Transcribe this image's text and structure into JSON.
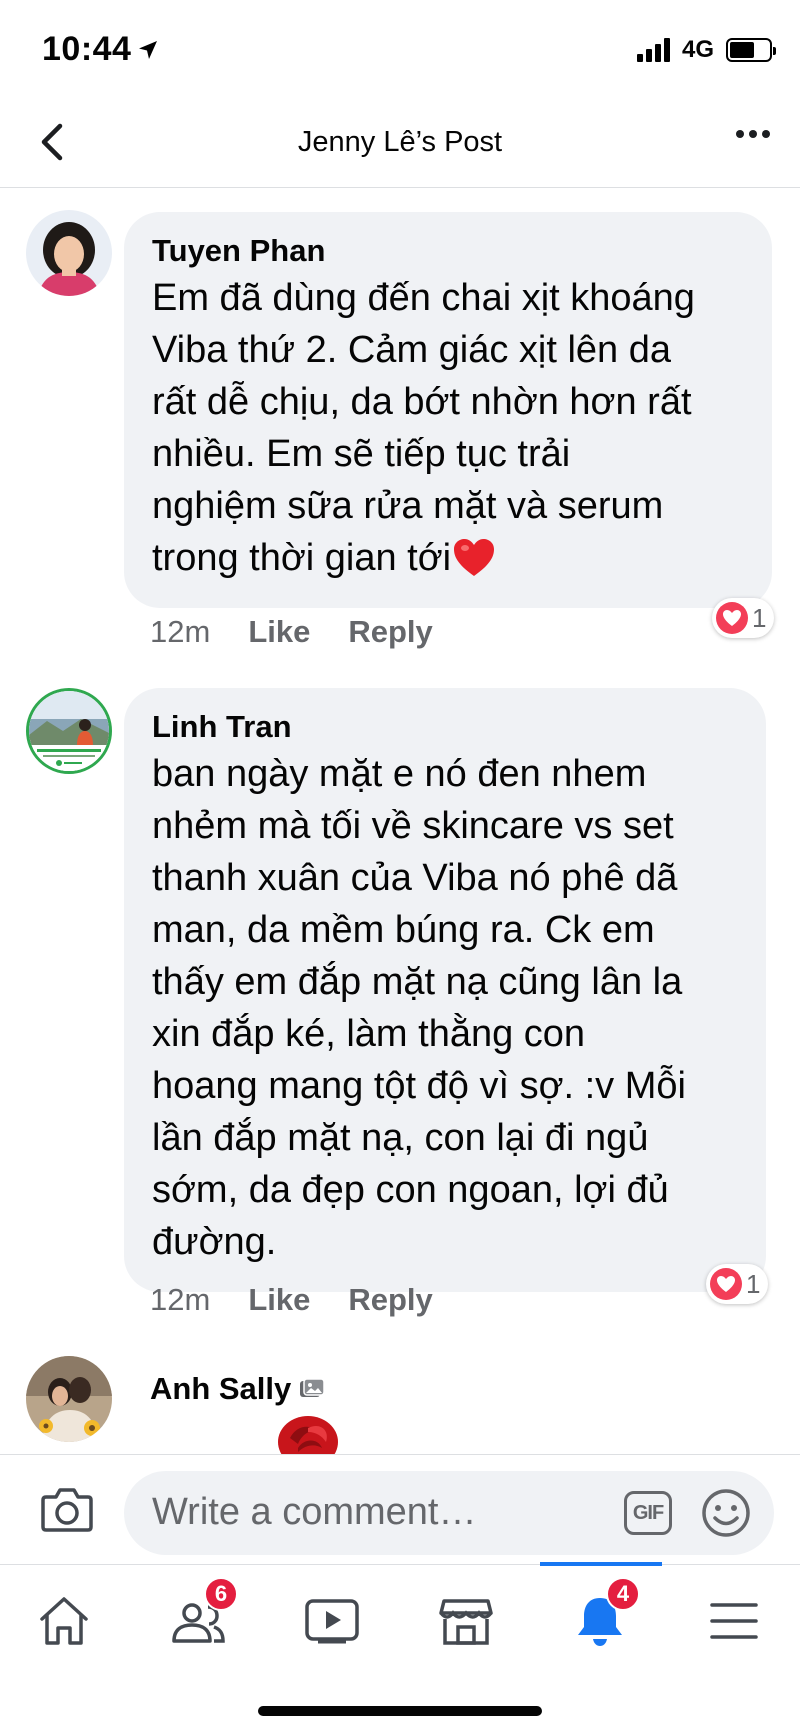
{
  "status_bar": {
    "time": "10:44",
    "network": "4G"
  },
  "header": {
    "title": "Jenny Lê’s Post"
  },
  "comments": [
    {
      "author": "Tuyen Phan",
      "lines": [
        "Em đã dùng đến chai xịt khoáng",
        "Viba thứ 2. Cảm giác xịt lên da",
        "rất dễ chịu, da bớt nhờn hơn rất",
        "nhiều. Em sẽ tiếp tục trải",
        "nghiệm sữa rửa mặt và serum",
        "trong thời gian tới"
      ],
      "time": "12m",
      "like_label": "Like",
      "reply_label": "Reply",
      "reaction_count": "1"
    },
    {
      "author": "Linh Tran",
      "lines": [
        "ban ngày mặt e nó đen nhem",
        "nhẻm mà tối về skincare vs set",
        "thanh xuân của Viba nó phê dã",
        "man, da mềm búng ra. Ck em",
        "thấy em đắp mặt nạ cũng lân la",
        "xin đắp ké, làm thằng con",
        "hoang mang tột độ vì sợ. :v  Mỗi",
        "lần đắp mặt nạ, con lại đi ngủ",
        "sớm, da đẹp con ngoan, lợi đủ",
        "đường."
      ],
      "time": "12m",
      "like_label": "Like",
      "reply_label": "Reply",
      "reaction_count": "1"
    },
    {
      "author": "Anh Sally"
    }
  ],
  "composer": {
    "placeholder": "Write a comment…",
    "gif_label": "GIF"
  },
  "tabs": [
    {
      "name": "home-icon"
    },
    {
      "name": "friends-icon",
      "badge": "6"
    },
    {
      "name": "watch-icon"
    },
    {
      "name": "marketplace-icon"
    },
    {
      "name": "notifications-icon",
      "badge": "4",
      "active": true
    },
    {
      "name": "menu-icon"
    }
  ],
  "colors": {
    "accent": "#1877f2",
    "badge": "#e41e3f",
    "heart": "#f33e58",
    "bubble": "#f0f2f5"
  }
}
